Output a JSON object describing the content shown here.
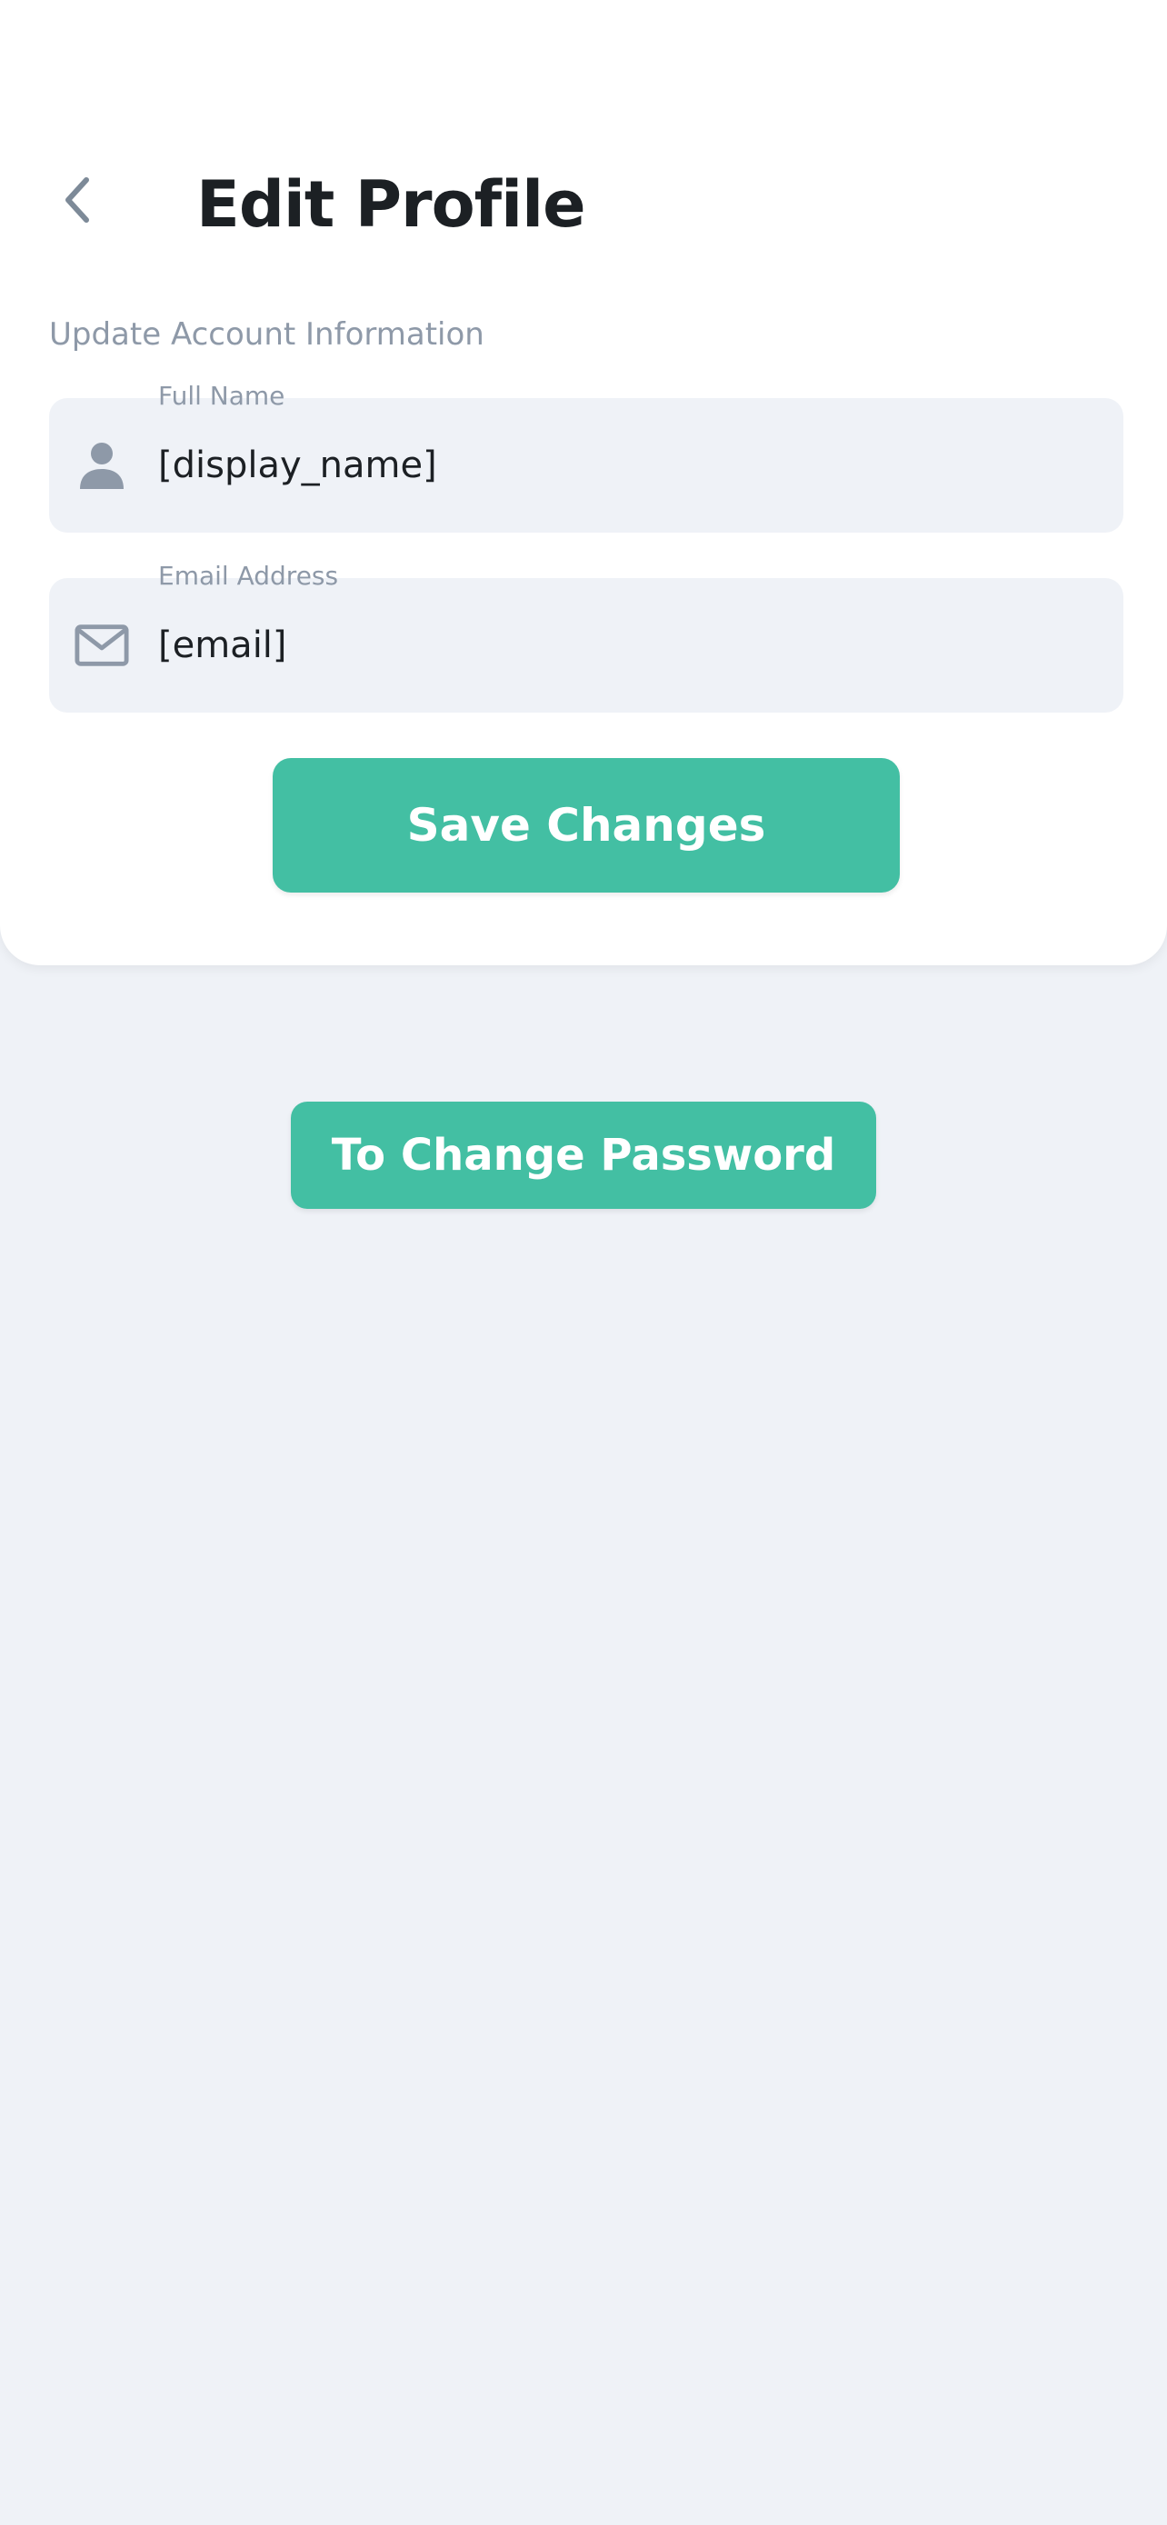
{
  "header": {
    "title": "Edit Profile",
    "back_icon": "chevron-left-icon"
  },
  "form": {
    "section_label": "Update Account Information",
    "full_name": {
      "label": "Full Name",
      "value": "[display_name]",
      "icon": "person-icon"
    },
    "email": {
      "label": "Email Address",
      "value": "[email]",
      "icon": "envelope-icon"
    },
    "save_label": "Save Changes"
  },
  "change_password_label": "To Change Password",
  "colors": {
    "accent": "#43bfa3",
    "background": "#eff2f7",
    "card": "#ffffff",
    "muted_text": "#8e99a8",
    "title_text": "#1c2024"
  }
}
